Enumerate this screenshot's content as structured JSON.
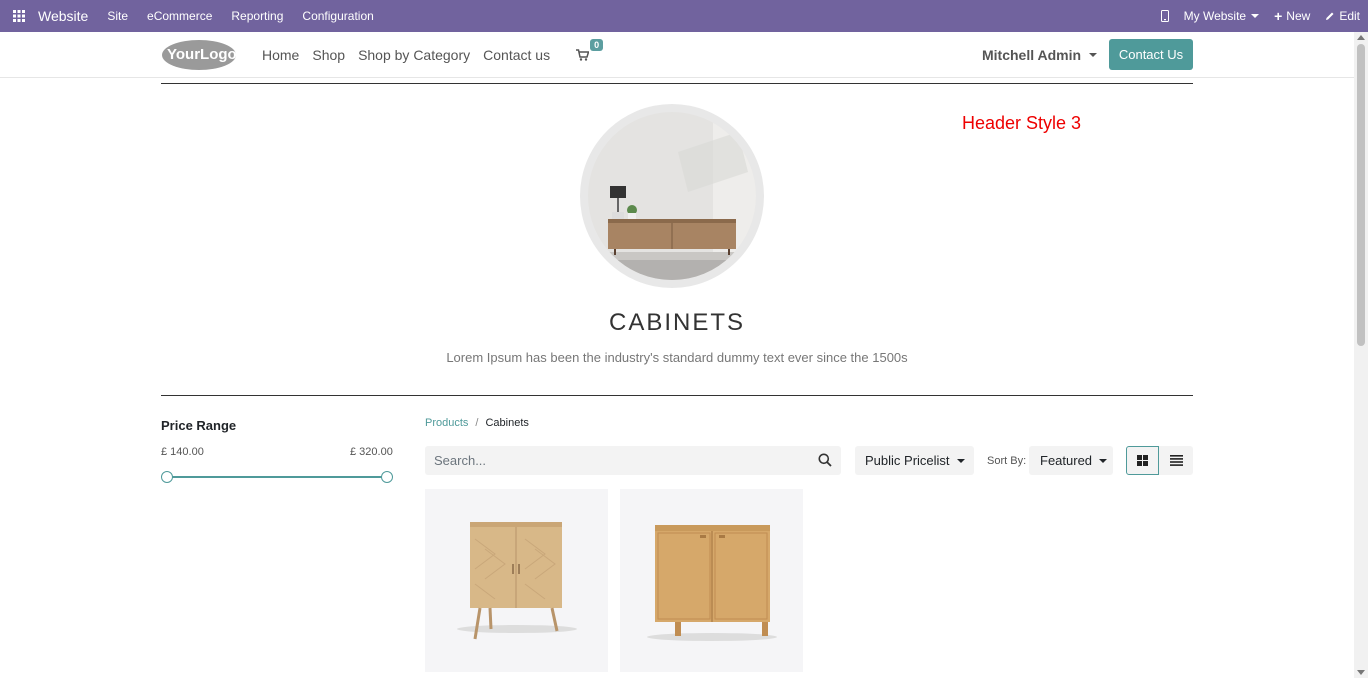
{
  "topbar": {
    "brand": "Website",
    "menus": [
      "Site",
      "eCommerce",
      "Reporting",
      "Configuration"
    ],
    "website_switcher": "My Website",
    "new_label": "New",
    "edit_label": "Edit"
  },
  "navbar": {
    "logo_text": "YourLogo",
    "links": [
      "Home",
      "Shop",
      "Shop by Category",
      "Contact us"
    ],
    "cart_count": "0",
    "user": "Mitchell Admin",
    "contact_button": "Contact Us"
  },
  "annotation": "Header Style 3",
  "category": {
    "title": "CABINETS",
    "description": "Lorem Ipsum has been the industry's standard dummy text ever since the 1500s"
  },
  "filter": {
    "title": "Price Range",
    "min": "£ 140.00",
    "max": "£ 320.00",
    "range_min_fraction": 0,
    "range_max_fraction": 1
  },
  "breadcrumb": {
    "parent": "Products",
    "current": "Cabinets"
  },
  "search": {
    "placeholder": "Search...",
    "value": ""
  },
  "pricelist": "Public Pricelist",
  "sort": {
    "label": "Sort By:",
    "value": "Featured"
  },
  "colors": {
    "topbar": "#71639e",
    "accent": "#4f9a9a",
    "annotation": "#ee0000"
  }
}
